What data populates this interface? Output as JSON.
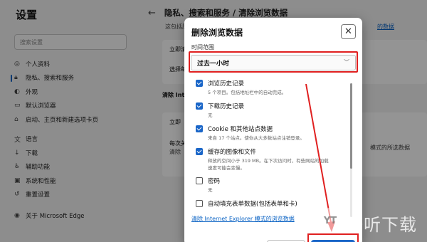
{
  "sidebar": {
    "title": "设置",
    "search_placeholder": "搜索设置",
    "items": [
      {
        "icon": "person-icon",
        "glyph": "◎",
        "label": "个人资料"
      },
      {
        "icon": "lock-icon",
        "glyph": "🔒︎",
        "label": "隐私、搜索和服务"
      },
      {
        "icon": "appearance-icon",
        "glyph": "◐",
        "label": "外观"
      },
      {
        "icon": "browser-icon",
        "glyph": "▭",
        "label": "默认浏览器"
      },
      {
        "icon": "home-icon",
        "glyph": "⌂",
        "label": "启动、主页和新建选项卡页"
      },
      {
        "icon": "language-icon",
        "glyph": "文",
        "label": "语言"
      },
      {
        "icon": "download-icon",
        "glyph": "↓",
        "label": "下载"
      },
      {
        "icon": "accessibility-icon",
        "glyph": "♿︎",
        "label": "辅助功能"
      },
      {
        "icon": "system-icon",
        "glyph": "▣",
        "label": "系统和性能"
      },
      {
        "icon": "reset-icon",
        "glyph": "↺",
        "label": "重置设置"
      },
      {
        "icon": "edge-icon",
        "glyph": "◉",
        "label": "关于 Microsoft Edge"
      }
    ]
  },
  "main": {
    "breadcrumb": "隐私、搜索和服务 / 清除浏览数据",
    "line1": "这包括历",
    "line1_link": "的数据",
    "line2": "立即清除",
    "line3": "选择每",
    "line4": "清除 Inte",
    "line5": "立即",
    "line6": "每次关",
    "line7": "清除",
    "line8": "模式的所选数据"
  },
  "dialog": {
    "title": "删除浏览数据",
    "close": "✕",
    "range_label": "时间范围",
    "range_value": "过去一小时",
    "options": [
      {
        "label": "浏览历史记录",
        "desc": "5 个项目。包括地址栏中的自动完成。",
        "checked": true
      },
      {
        "label": "下载历史记录",
        "desc": "无",
        "checked": true
      },
      {
        "label": "Cookie 和其他站点数据",
        "desc": "来自 17 个站点。使你从大多数站点注销登录。",
        "checked": true
      },
      {
        "label": "缓存的图像和文件",
        "desc": "释放的空间小于 319 MB。在下次访问时，有些网站的加载速度可能会变慢。",
        "checked": true
      },
      {
        "label": "密码",
        "desc": "无",
        "checked": false
      },
      {
        "label": "自动填充表单数据(包括表单和卡)",
        "desc": "",
        "checked": false
      }
    ],
    "ie_link": "清除 Internet Explorer 模式的浏览数据"
  },
  "watermark": {
    "logo": "YT",
    "text": "一听下载"
  },
  "colors": {
    "accent": "#1a66c8",
    "annotation": "#e02020",
    "link": "#0b63c4"
  }
}
